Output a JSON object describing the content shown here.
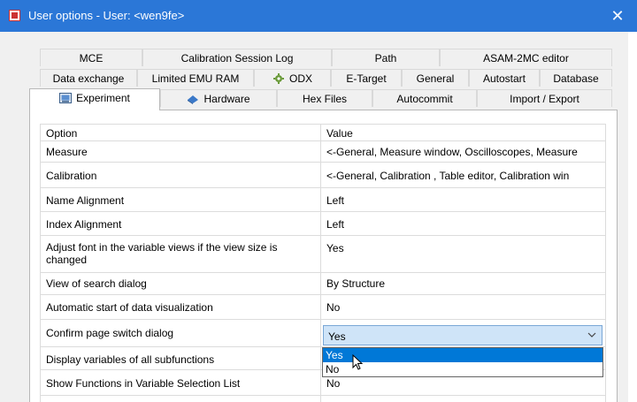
{
  "window": {
    "title": "User options - User: <wen9fe>",
    "close_glyph": "✕"
  },
  "tabs": {
    "row1": [
      "MCE",
      "Calibration Session Log",
      "Path",
      "ASAM-2MC editor"
    ],
    "row2": [
      "Data exchange",
      "Limited EMU RAM",
      "ODX",
      "E-Target",
      "General",
      "Autostart",
      "Database"
    ],
    "row3": [
      "Experiment",
      "Hardware",
      "Hex Files",
      "Autocommit",
      "Import / Export"
    ]
  },
  "table": {
    "headers": [
      "Option",
      "Value"
    ],
    "rows": [
      {
        "option": "Measure",
        "value": "<-General, Measure window, Oscilloscopes, Measure"
      },
      {
        "option": "Calibration",
        "value": "<-General, Calibration , Table editor, Calibration win"
      },
      {
        "option": "Name Alignment",
        "value": "Left"
      },
      {
        "option": "Index Alignment",
        "value": "Left"
      },
      {
        "option": "Adjust font in the variable views if the view size is changed",
        "value": "Yes"
      },
      {
        "option": "View of search dialog",
        "value": "By Structure"
      },
      {
        "option": "Automatic start of data visualization",
        "value": "No"
      },
      {
        "option": "Confirm page switch dialog",
        "value": "Yes"
      },
      {
        "option": "Display variables of all subfunctions",
        "value": ""
      },
      {
        "option": "Show Functions in Variable Selection List",
        "value": "No"
      }
    ]
  },
  "dropdown": {
    "selected": "Yes",
    "options": [
      "Yes",
      "No"
    ]
  },
  "colors": {
    "titlebar": "#2b77d7",
    "selection": "#0078d7",
    "dropdown_bg": "#cfe4f8"
  }
}
